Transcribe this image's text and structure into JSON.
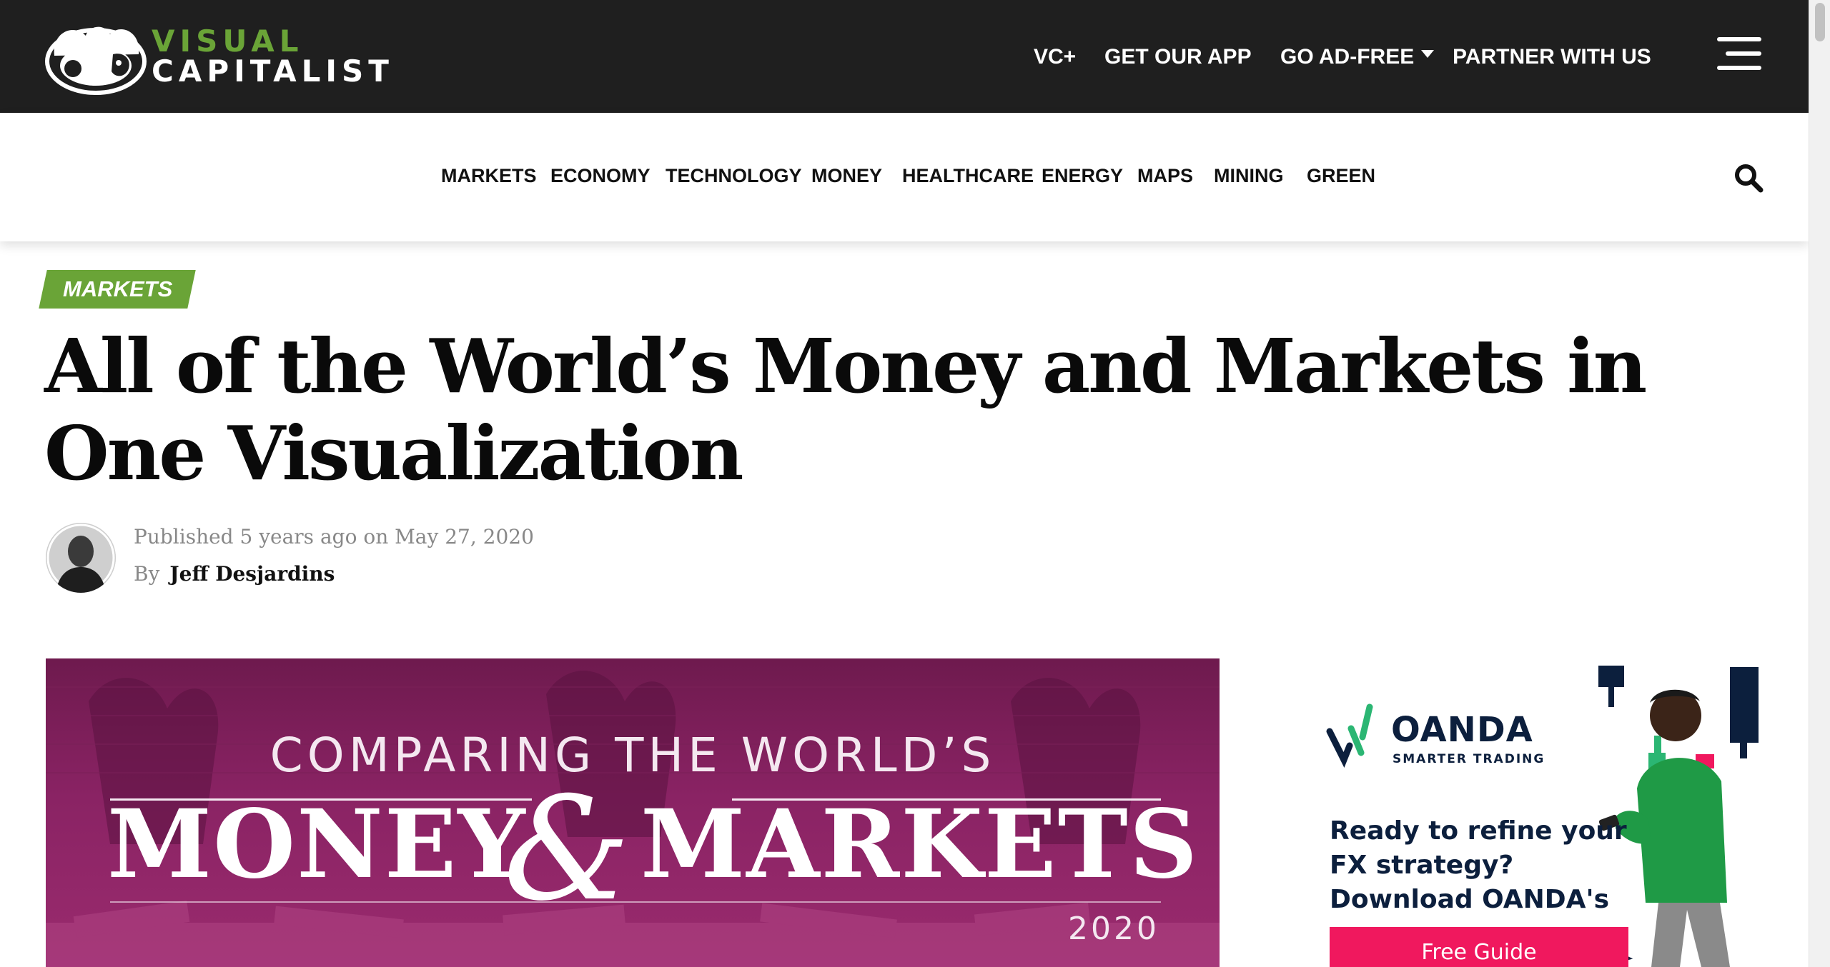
{
  "logo": {
    "line1": "VISUAL",
    "line2": "CAPITALIST"
  },
  "topnav": {
    "vc_plus": "VC+",
    "get_app": "GET OUR APP",
    "ad_free": "GO AD-FREE",
    "partner": "PARTNER WITH US"
  },
  "categories": [
    "MARKETS",
    "ECONOMY",
    "TECHNOLOGY",
    "MONEY",
    "HEALTHCARE",
    "ENERGY",
    "MAPS",
    "MINING",
    "GREEN"
  ],
  "article": {
    "tag": "MARKETS",
    "title": "All of the World’s Money and Markets in One Visualization",
    "published": "Published 5 years ago on May 27, 2020",
    "by": "By",
    "author": "Jeff Desjardins"
  },
  "hero": {
    "line1": "COMPARING THE WORLD’S",
    "money": "MONEY",
    "amp": "&",
    "markets": "MARKETS",
    "year": "2020"
  },
  "ad": {
    "brand": "OANDA",
    "tagline": "SMARTER TRADING",
    "copy": "Ready to refine your FX strategy? Download OANDA's",
    "cta": "Free Guide"
  },
  "colors": {
    "topbar": "#1f1f1f",
    "accent_green": "#6aa437",
    "hero_magenta": "#8a2364",
    "ad_navy": "#0c1f3d",
    "ad_pink": "#f0185e"
  }
}
